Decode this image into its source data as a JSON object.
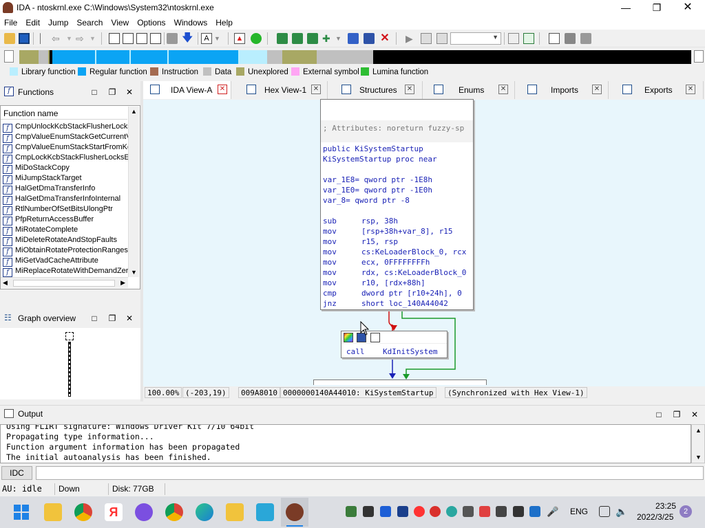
{
  "window": {
    "title": "IDA - ntoskrnl.exe C:\\Windows\\System32\\ntoskrnl.exe"
  },
  "menu": [
    "File",
    "Edit",
    "Jump",
    "Search",
    "View",
    "Options",
    "Windows",
    "Help"
  ],
  "legend": [
    {
      "label": "Library function",
      "color": "#b9eefe"
    },
    {
      "label": "Regular function",
      "color": "#0ba4f4"
    },
    {
      "label": "Instruction",
      "color": "#a56b51"
    },
    {
      "label": "Data",
      "color": "#c0c0c0"
    },
    {
      "label": "Unexplored",
      "color": "#a8a864"
    },
    {
      "label": "External symbol",
      "color": "#ffa6f4"
    },
    {
      "label": "Lumina function",
      "color": "#2ebd33"
    }
  ],
  "functions_panel": {
    "title": "Functions",
    "column": "Function name",
    "items": [
      "CmpUnlockKcbStackFlusherLocksE",
      "CmpValueEnumStackGetCurrentV",
      "CmpValueEnumStackStartFromKe",
      "CmpLockKcbStackFlusherLocksEx",
      "MiDoStackCopy",
      "MiJumpStackTarget",
      "HalGetDmaTransferInfo",
      "HalGetDmaTransferInfoInternal",
      "RtlNumberOfSetBitsUlongPtr",
      "PfpReturnAccessBuffer",
      "MiRotateComplete",
      "MiDeleteRotateAndStopFaults",
      "MiObtainRotateProtectionRanges",
      "MiGetVadCacheAttribute",
      "MiReplaceRotateWithDemandZer"
    ]
  },
  "graph_overview": {
    "title": "Graph overview"
  },
  "tabs": [
    {
      "label": "IDA View-A",
      "active": true
    },
    {
      "label": "Hex View-1"
    },
    {
      "label": "Structures"
    },
    {
      "label": "Enums"
    },
    {
      "label": "Imports"
    },
    {
      "label": "Exports"
    }
  ],
  "node1": {
    "comment": "; Attributes: noreturn fuzzy-sp",
    "lines": [
      {
        "a": "public ",
        "b": "KiSystemStartup"
      },
      {
        "a": "KiSystemStartup proc near",
        "b": ""
      },
      {
        "a": "",
        "b": ""
      },
      {
        "a": "var_1E8= qword ptr -1E8h",
        "b": ""
      },
      {
        "a": "var_1E0= qword ptr -1E0h",
        "b": ""
      },
      {
        "a": "var_8= qword ptr -8",
        "b": ""
      },
      {
        "a": "",
        "b": ""
      }
    ],
    "insns": [
      {
        "op": "sub",
        "args": "rsp, 38h"
      },
      {
        "op": "mov",
        "args": "[rsp+38h+var_8], r15"
      },
      {
        "op": "mov",
        "args": "r15, rsp"
      },
      {
        "op": "mov",
        "args": "cs:KeLoaderBlock_0, rcx"
      },
      {
        "op": "mov",
        "args": "ecx, 0FFFFFFFFh"
      },
      {
        "op": "mov",
        "args": "rdx, cs:KeLoaderBlock_0"
      },
      {
        "op": "mov",
        "args": "r10, [rdx+88h]"
      },
      {
        "op": "cmp",
        "args": "dword ptr [r10+24h], 0"
      },
      {
        "op": "jnz",
        "args": "short loc_140A44042"
      }
    ]
  },
  "node2": {
    "op": "call",
    "target": "KdInitSystem"
  },
  "graph_status": {
    "zoom": "100.00%",
    "coords": "(-203,19)",
    "offset": "009A8010",
    "address": "0000000140A44010: KiSystemStartup",
    "sync": "(Synchronized with Hex View-1)"
  },
  "output": {
    "title": "Output",
    "lines": [
      "Using FLIRT signature: Windows Driver Kit 7/10 64bit",
      "Propagating type information...",
      "Function argument information has been propagated",
      "The initial autoanalysis has been finished."
    ],
    "idc_label": "IDC"
  },
  "status": {
    "au": "AU:",
    "state": "idle",
    "dir": "Down",
    "disk": "Disk: 77GB"
  },
  "taskbar": {
    "lang": "ENG",
    "time": "23:25",
    "date": "2022/3/25",
    "badge": "2"
  }
}
